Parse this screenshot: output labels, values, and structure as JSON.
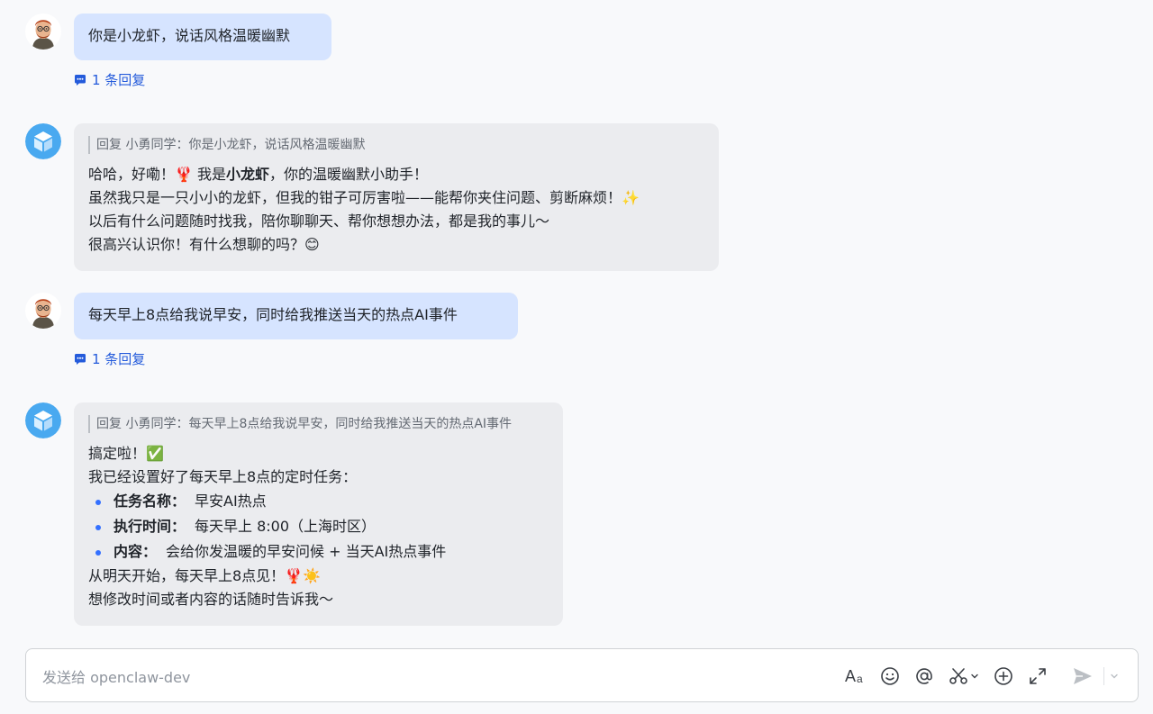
{
  "messages": [
    {
      "role": "user",
      "text": "你是小龙虾，说话风格温暖幽默",
      "reply_count_label": "1 条回复"
    },
    {
      "role": "bot",
      "quote": "回复 小勇同学：你是小龙虾，说话风格温暖幽默",
      "line1_a": "哈哈，好嘞！🦞 我是",
      "line1_bold": "小龙虾",
      "line1_b": "，你的温暖幽默小助手！",
      "line2": "虽然我只是一只小小的龙虾，但我的钳子可厉害啦——能帮你夹住问题、剪断麻烦！✨",
      "line3": "以后有什么问题随时找我，陪你聊聊天、帮你想想办法，都是我的事儿～",
      "line4": "很高兴认识你！有什么想聊的吗？😊"
    },
    {
      "role": "user",
      "text": "每天早上8点给我说早安，同时给我推送当天的热点AI事件",
      "reply_count_label": "1 条回复"
    },
    {
      "role": "bot",
      "quote": "回复 小勇同学：每天早上8点给我说早安，同时给我推送当天的热点AI事件",
      "line1": "搞定啦！✅",
      "line2": "我已经设置好了每天早上8点的定时任务：",
      "bullets": [
        {
          "label": "任务名称：",
          "value": "早安AI热点"
        },
        {
          "label": "执行时间：",
          "value": "每天早上 8:00（上海时区）"
        },
        {
          "label": "内容：",
          "value": "会给你发温暖的早安问候 + 当天AI热点事件"
        }
      ],
      "line3": "从明天开始，每天早上8点见！🦞☀️",
      "line4": "想修改时间或者内容的话随时告诉我～"
    }
  ],
  "composer": {
    "placeholder": "发送给 openclaw-dev"
  },
  "colors": {
    "user_bubble": "#d6e4ff",
    "bot_bubble": "#ebecef",
    "accent": "#245bdb"
  },
  "icons": [
    "user-avatar",
    "bot-avatar-cube-icon",
    "thread-reply-icon",
    "font-format-icon",
    "emoji-icon",
    "mention-icon",
    "scissors-icon",
    "add-icon",
    "expand-icon",
    "send-icon",
    "chevron-down-icon"
  ]
}
